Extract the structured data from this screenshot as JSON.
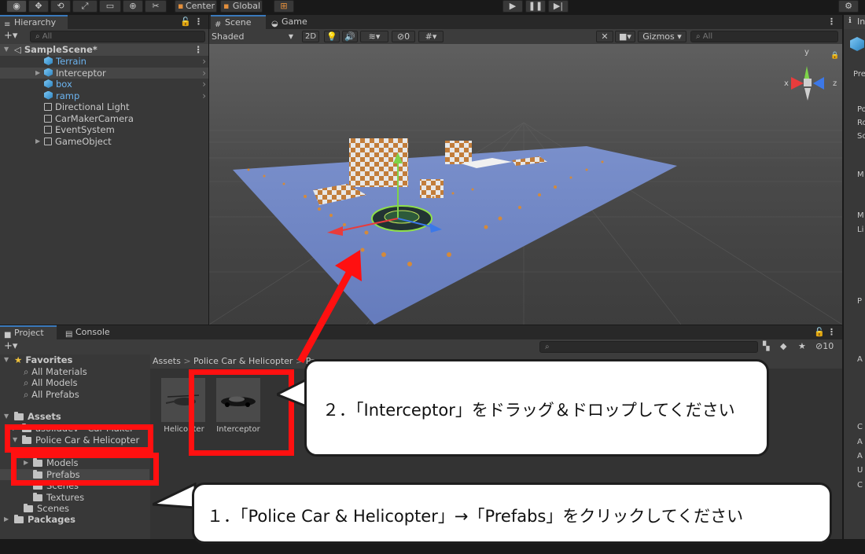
{
  "toolbar": {
    "pivot_label": "Center",
    "space_label": "Global"
  },
  "hierarchy": {
    "tab_label": "Hierarchy",
    "search_placeholder": "All",
    "scene_name": "SampleScene*",
    "items": [
      {
        "label": "Terrain",
        "blue": true
      },
      {
        "label": "Interceptor",
        "blue": false
      },
      {
        "label": "box",
        "blue": true
      },
      {
        "label": "ramp",
        "blue": true
      },
      {
        "label": "Directional Light",
        "blue": false
      },
      {
        "label": "CarMakerCamera",
        "blue": false
      },
      {
        "label": "EventSystem",
        "blue": false
      },
      {
        "label": "GameObject",
        "blue": false
      }
    ]
  },
  "scene_view": {
    "tab_scene": "Scene",
    "tab_game": "Game",
    "shading_mode": "Shaded",
    "mode_2d": "2D",
    "hidden_count": "0",
    "gizmos_label": "Gizmos",
    "search_placeholder": "All",
    "gizmo_axes": {
      "y": "y",
      "x": "x",
      "z": "z"
    },
    "axis_colors": {
      "x": "#e83c3c",
      "y": "#7ed349",
      "z": "#3c78e8"
    }
  },
  "project": {
    "tab_project": "Project",
    "tab_console": "Console",
    "hidden_count": "10",
    "favorites_label": "Favorites",
    "favorites": [
      "All Materials",
      "All Models",
      "All Prefabs"
    ],
    "assets_label": "Assets",
    "asset_tree": [
      {
        "label": "asoliddev - Car Maker"
      },
      {
        "label": "Police Car & Helicopter"
      },
      {
        "label": "Models"
      },
      {
        "label": "Prefabs"
      },
      {
        "label": "Scenes"
      },
      {
        "label": "Textures"
      },
      {
        "label": "Scenes"
      }
    ],
    "packages_label": "Packages",
    "breadcrumb": [
      "Assets",
      "Police Car & Helicopter",
      "Pr"
    ],
    "grid_items": [
      {
        "label": "Helicopter"
      },
      {
        "label": "Interceptor"
      }
    ]
  },
  "inspector": {
    "tab_label": "In",
    "partial_labels": [
      "Pre",
      "Po",
      "Ro",
      "Sc",
      "M",
      "M",
      "Li",
      "P",
      "A",
      "C",
      "A",
      "A",
      "U",
      "C"
    ]
  },
  "annotations": {
    "step1": "１．「Police Car & Helicopter」→「Prefabs」をクリックしてください",
    "step2": "２．「Interceptor」をドラッグ＆ドロップしてください",
    "highlight_color": "#ff1010"
  }
}
